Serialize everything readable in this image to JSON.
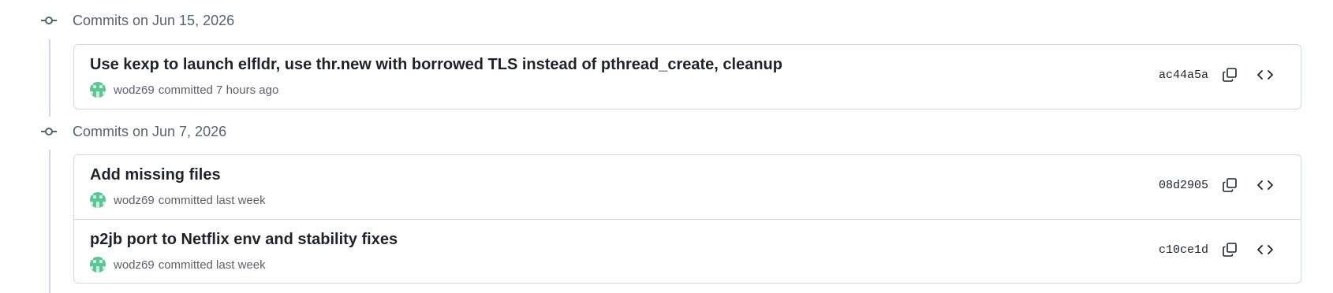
{
  "groups": [
    {
      "title": "Commits on Jun 15, 2026",
      "commits": [
        {
          "message": "Use kexp to launch elfldr, use thr.new with borrowed TLS instead of pthread_create, cleanup",
          "author": "wodz69",
          "time": "committed 7 hours ago",
          "sha": "ac44a5a"
        }
      ]
    },
    {
      "title": "Commits on Jun 7, 2026",
      "commits": [
        {
          "message": "Add missing files",
          "author": "wodz69",
          "time": "committed last week",
          "sha": "08d2905"
        },
        {
          "message": "p2jb port to Netflix env and stability fixes",
          "author": "wodz69",
          "time": "committed last week",
          "sha": "c10ce1d"
        }
      ]
    }
  ],
  "icons": {
    "node": "git-commit-icon",
    "copy": "copy-icon",
    "browse": "code-icon",
    "avatar": "identicon-avatar"
  },
  "colors": {
    "avatar_fg": "#5ec49a",
    "avatar_bg": "#c7efd9",
    "muted": "#59636e",
    "border": "#d1d9e0"
  }
}
